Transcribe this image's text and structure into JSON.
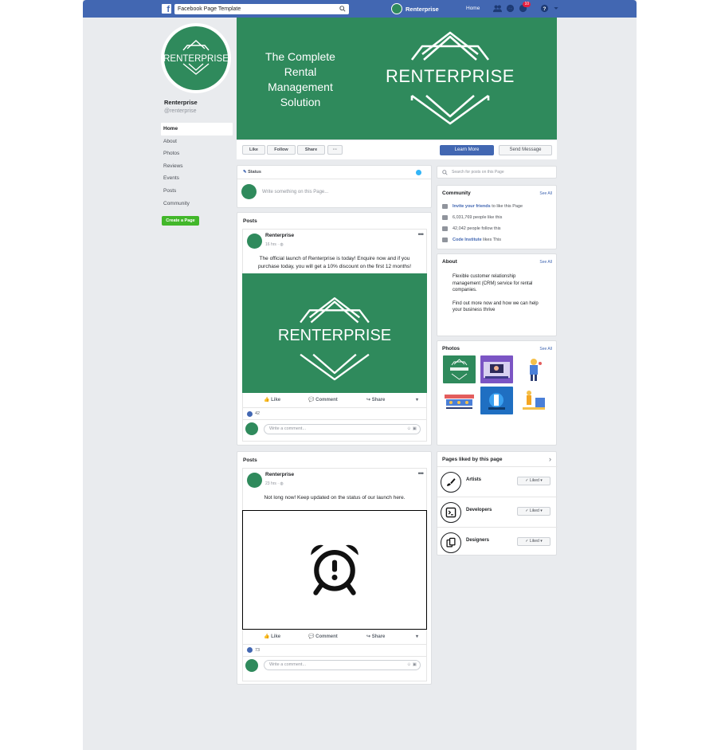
{
  "topbar": {
    "search_value": "Facebook Page Template",
    "profile_name": "Renterprise",
    "home_label": "Home",
    "notification_count": "10"
  },
  "page": {
    "name": "Renterprise",
    "handle": "@renterprise",
    "nav": [
      "Home",
      "About",
      "Photos",
      "Reviews",
      "Events",
      "Posts",
      "Community"
    ],
    "create_page": "Create a Page"
  },
  "cover": {
    "tagline_1": "The Complete",
    "tagline_2": "Rental",
    "tagline_3": "Management",
    "tagline_4": "Solution",
    "logo_text": "RENTERPRISE",
    "color": "#2f8a5c"
  },
  "profile_logo_text": "RENTERPRISE",
  "actions": {
    "like": "Like",
    "follow": "Follow",
    "share": "Share",
    "more": "···",
    "learn_more": "Learn More",
    "send_message": "Send Message"
  },
  "status": {
    "label": "Status",
    "placeholder": "Write something on this Page..."
  },
  "posts": [
    {
      "section_label": "Posts",
      "author": "Renterprise",
      "time": "16 hrs",
      "text": "The official launch of Renterprise is today! Enquire now and if you purchase today, you will get a 10% discount on the first 12 months!",
      "image_text": "RENTERPRISE",
      "like_label": "Like",
      "comment_label": "Comment",
      "share_label": "Share",
      "likes": "42",
      "comment_placeholder": "Write a comment..."
    },
    {
      "section_label": "Posts",
      "author": "Renterprise",
      "time": "23 hrs",
      "text": "Not long now! Keep updated on the status of our launch here.",
      "like_label": "Like",
      "comment_label": "Comment",
      "share_label": "Share",
      "likes": "73",
      "comment_placeholder": "Write a comment..."
    }
  ],
  "sidebar": {
    "search_placeholder": "Search for posts on this Page",
    "community": {
      "title": "Community",
      "see_all": "See All",
      "invite_link": "Invite your friends",
      "invite_rest": "to like this Page",
      "likes_line": "6,031,769 people like this",
      "follows_line": "42,042 people follow this",
      "friend_link": "Code Institute",
      "friend_rest": "likes This"
    },
    "about": {
      "title": "About",
      "see_all": "See All",
      "line1": "Flexible customer relationship management (CRM) service for rental companies.",
      "line2": "Find out more now and how we can help your business thrive"
    },
    "photos": {
      "title": "Photos",
      "see_all": "See All"
    },
    "liked": {
      "title": "Pages liked by this page",
      "items": [
        {
          "name": "Artists",
          "button": "Liked"
        },
        {
          "name": "Developers",
          "button": "Liked"
        },
        {
          "name": "Designers",
          "button": "Liked"
        }
      ]
    }
  }
}
